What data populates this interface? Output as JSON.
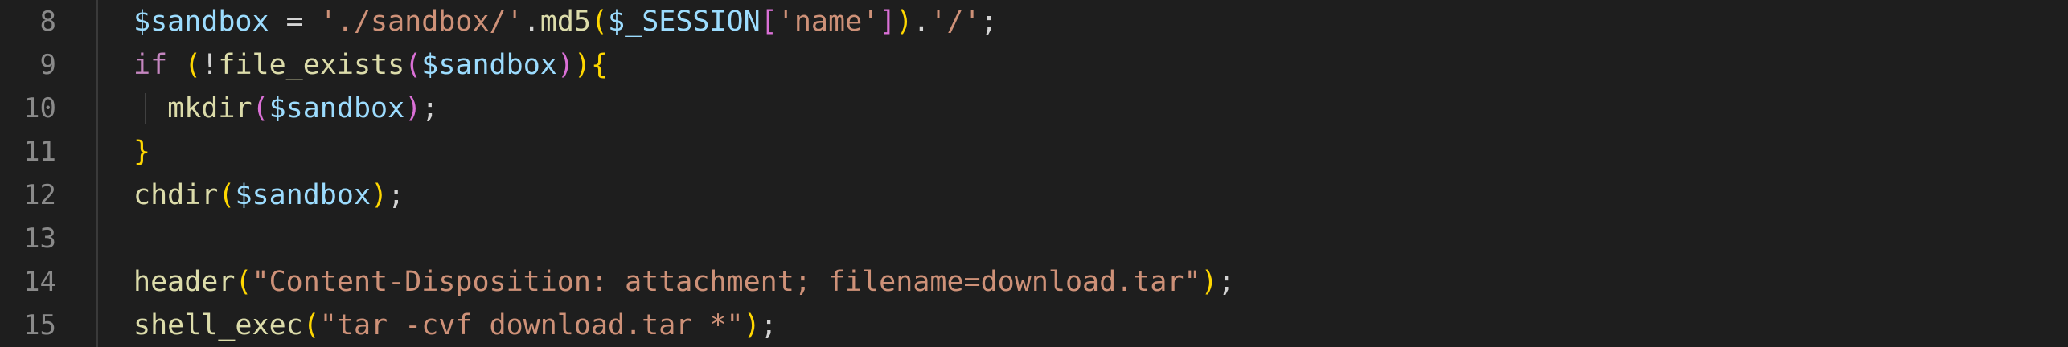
{
  "editor": {
    "lines": [
      {
        "number": "8",
        "tokens": [
          {
            "text": "$sandbox",
            "cls": "var"
          },
          {
            "text": " = ",
            "cls": "punc"
          },
          {
            "text": "'./sandbox/'",
            "cls": "str"
          },
          {
            "text": ".",
            "cls": "punc"
          },
          {
            "text": "md5",
            "cls": "fn"
          },
          {
            "text": "(",
            "cls": "br1"
          },
          {
            "text": "$_SESSION",
            "cls": "var"
          },
          {
            "text": "[",
            "cls": "br2"
          },
          {
            "text": "'name'",
            "cls": "str"
          },
          {
            "text": "]",
            "cls": "br2"
          },
          {
            "text": ")",
            "cls": "br1"
          },
          {
            "text": ".",
            "cls": "punc"
          },
          {
            "text": "'/'",
            "cls": "str"
          },
          {
            "text": ";",
            "cls": "punc"
          }
        ]
      },
      {
        "number": "9",
        "tokens": [
          {
            "text": "if",
            "cls": "kw"
          },
          {
            "text": " ",
            "cls": "punc"
          },
          {
            "text": "(",
            "cls": "br1"
          },
          {
            "text": "!",
            "cls": "punc"
          },
          {
            "text": "file_exists",
            "cls": "fn"
          },
          {
            "text": "(",
            "cls": "br2"
          },
          {
            "text": "$sandbox",
            "cls": "var"
          },
          {
            "text": ")",
            "cls": "br2"
          },
          {
            "text": ")",
            "cls": "br1"
          },
          {
            "text": "{",
            "cls": "br1"
          }
        ]
      },
      {
        "number": "10",
        "indent": true,
        "tokens": [
          {
            "text": "  ",
            "cls": "punc"
          },
          {
            "text": "mkdir",
            "cls": "fn"
          },
          {
            "text": "(",
            "cls": "br2"
          },
          {
            "text": "$sandbox",
            "cls": "var"
          },
          {
            "text": ")",
            "cls": "br2"
          },
          {
            "text": ";",
            "cls": "punc"
          }
        ]
      },
      {
        "number": "11",
        "tokens": [
          {
            "text": "}",
            "cls": "br1"
          }
        ]
      },
      {
        "number": "12",
        "tokens": [
          {
            "text": "chdir",
            "cls": "fn"
          },
          {
            "text": "(",
            "cls": "br1"
          },
          {
            "text": "$sandbox",
            "cls": "var"
          },
          {
            "text": ")",
            "cls": "br1"
          },
          {
            "text": ";",
            "cls": "punc"
          }
        ]
      },
      {
        "number": "13",
        "tokens": []
      },
      {
        "number": "14",
        "tokens": [
          {
            "text": "header",
            "cls": "fn"
          },
          {
            "text": "(",
            "cls": "br1"
          },
          {
            "text": "\"Content-Disposition: attachment; filename=download.tar\"",
            "cls": "str"
          },
          {
            "text": ")",
            "cls": "br1"
          },
          {
            "text": ";",
            "cls": "punc"
          }
        ]
      },
      {
        "number": "15",
        "tokens": [
          {
            "text": "shell_exec",
            "cls": "fn"
          },
          {
            "text": "(",
            "cls": "br1"
          },
          {
            "text": "\"tar -cvf download.tar *\"",
            "cls": "str"
          },
          {
            "text": ")",
            "cls": "br1"
          },
          {
            "text": ";",
            "cls": "punc"
          }
        ]
      }
    ]
  }
}
